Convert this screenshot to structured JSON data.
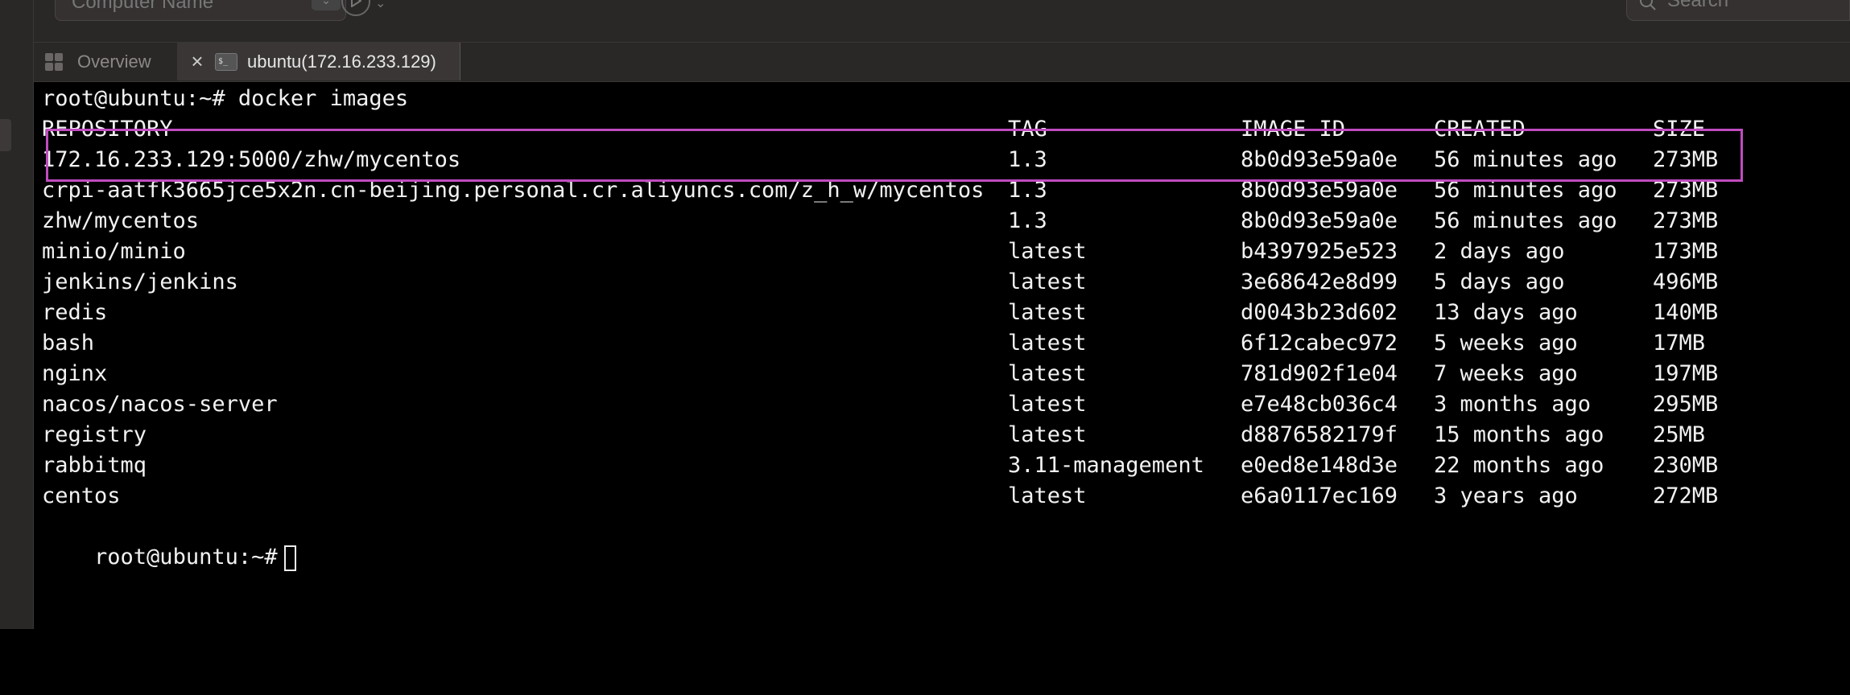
{
  "toolbar": {
    "computer_placeholder": "Computer Name",
    "search_placeholder": "Search"
  },
  "tabs": {
    "overview": "Overview",
    "session": "ubuntu(172.16.233.129)",
    "session_icon_text": "$_"
  },
  "terminal": {
    "command_line": "root@ubuntu:~# docker images",
    "prompt": "root@ubuntu:~#",
    "headers": [
      "REPOSITORY",
      "TAG",
      "IMAGE ID",
      "CREATED",
      "SIZE"
    ],
    "rows": [
      [
        "172.16.233.129:5000/zhw/mycentos",
        "1.3",
        "8b0d93e59a0e",
        "56 minutes ago",
        "273MB"
      ],
      [
        "crpi-aatfk3665jce5x2n.cn-beijing.personal.cr.aliyuncs.com/z_h_w/mycentos",
        "1.3",
        "8b0d93e59a0e",
        "56 minutes ago",
        "273MB"
      ],
      [
        "zhw/mycentos",
        "1.3",
        "8b0d93e59a0e",
        "56 minutes ago",
        "273MB"
      ],
      [
        "minio/minio",
        "latest",
        "b4397925e523",
        "2 days ago",
        "173MB"
      ],
      [
        "jenkins/jenkins",
        "latest",
        "3e68642e8d99",
        "5 days ago",
        "496MB"
      ],
      [
        "redis",
        "latest",
        "d0043b23d602",
        "13 days ago",
        "140MB"
      ],
      [
        "bash",
        "latest",
        "6f12cabec972",
        "5 weeks ago",
        "17MB"
      ],
      [
        "nginx",
        "latest",
        "781d902f1e04",
        "7 weeks ago",
        "197MB"
      ],
      [
        "nacos/nacos-server",
        "latest",
        "e7e48cb036c4",
        "3 months ago",
        "295MB"
      ],
      [
        "registry",
        "latest",
        "d8876582179f",
        "15 months ago",
        "25MB"
      ],
      [
        "rabbitmq",
        "3.11-management",
        "e0ed8e148d3e",
        "22 months ago",
        "230MB"
      ],
      [
        "centos",
        "latest",
        "e6a0117ec169",
        "3 years ago",
        "272MB"
      ]
    ],
    "highlight_color": "#c04bc0"
  }
}
